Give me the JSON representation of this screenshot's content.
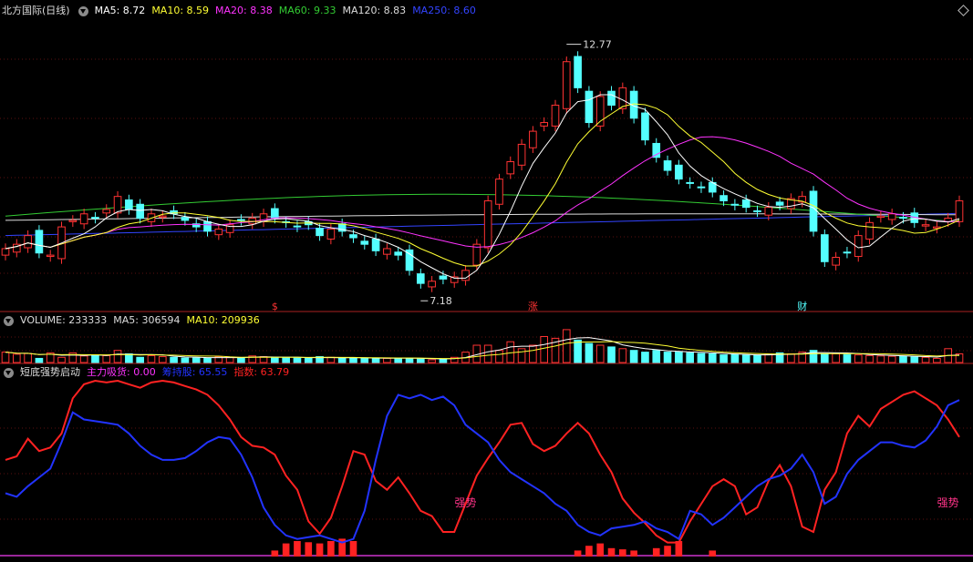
{
  "main": {
    "title": "北方国际(日线)",
    "ma": [
      {
        "label": "MA5: 8.72",
        "color": "#ffffff"
      },
      {
        "label": "MA10: 8.59",
        "color": "#ffff33"
      },
      {
        "label": "MA20: 8.38",
        "color": "#ff33ff"
      },
      {
        "label": "MA60: 9.33",
        "color": "#33cc33"
      },
      {
        "label": "MA120: 8.83",
        "color": "#dddddd"
      },
      {
        "label": "MA250: 8.60",
        "color": "#3344ff"
      }
    ],
    "high_label": "12.77",
    "low_label": "7.18",
    "markers": [
      {
        "label": "$",
        "x_index": 24
      },
      {
        "label": "涨",
        "x_index": 47
      },
      {
        "label": "财",
        "x_index": 71
      }
    ]
  },
  "volume": {
    "title": "VOLUME: 233333",
    "ma5": "MA5: 306594",
    "ma10": "MA10: 209936"
  },
  "indicator": {
    "title": "短底强势启动",
    "zlxh": "主力吸货: 0.00",
    "kpl": "筹持股: 65.55",
    "zs": "指数: 63.79",
    "labels": [
      {
        "text": "强势",
        "x_index": 41
      },
      {
        "text": "强势",
        "x_index": 84
      }
    ]
  },
  "colors": {
    "up": "#ff3333",
    "down": "#54ffff",
    "ind_red": "#ff2222",
    "ind_blue": "#2233ff",
    "purple": "#cc33cc"
  },
  "chart_data": [
    {
      "type": "candlestick",
      "name": "北方国际(日线)",
      "count": 86,
      "ylim": [
        6.8,
        13.4
      ],
      "close": [
        8.1,
        8.2,
        8.4,
        8.0,
        7.95,
        8.6,
        8.75,
        8.9,
        8.8,
        9.0,
        9.3,
        9.0,
        8.8,
        8.9,
        8.85,
        8.9,
        8.75,
        8.6,
        8.5,
        8.55,
        8.65,
        8.75,
        8.8,
        8.9,
        8.8,
        8.7,
        8.6,
        8.65,
        8.4,
        8.55,
        8.5,
        8.35,
        8.2,
        8.05,
        8.1,
        7.95,
        7.6,
        7.3,
        7.35,
        7.4,
        7.45,
        7.6,
        8.2,
        9.2,
        9.7,
        10.1,
        10.5,
        10.8,
        11.0,
        11.4,
        12.4,
        11.8,
        11.0,
        11.6,
        11.4,
        11.8,
        11.1,
        10.6,
        10.2,
        9.9,
        9.7,
        9.6,
        9.5,
        9.4,
        9.2,
        9.1,
        9.05,
        8.95,
        9.05,
        9.1,
        9.25,
        9.3,
        8.5,
        7.8,
        7.9,
        8.0,
        8.4,
        8.7,
        8.85,
        8.9,
        8.8,
        8.7,
        8.65,
        8.6,
        8.8,
        9.2
      ],
      "volume": [
        3.0,
        2.4,
        2.6,
        1.2,
        2.8,
        1.5,
        2.8,
        1.9,
        2.0,
        2.0,
        3.5,
        2.5,
        1.5,
        2.0,
        1.7,
        1.5,
        1.3,
        1.3,
        1.3,
        1.7,
        1.5,
        1.3,
        1.9,
        1.7,
        1.5,
        1.4,
        1.3,
        1.2,
        1.7,
        1.5,
        1.3,
        1.2,
        1.2,
        1.3,
        1.2,
        1.3,
        1.2,
        1.0,
        0.8,
        1.0,
        1.5,
        3.0,
        5.0,
        5.0,
        3.5,
        6.0,
        4.0,
        5.0,
        7.5,
        7.0,
        9.5,
        6.5,
        5.5,
        5.0,
        4.5,
        4.0,
        3.5,
        3.0,
        3.5,
        3.0,
        3.0,
        2.8,
        2.6,
        2.5,
        2.2,
        2.3,
        2.1,
        2.0,
        2.5,
        2.8,
        2.5,
        3.0,
        3.5,
        2.5,
        2.5,
        2.3,
        2.2,
        2.0,
        1.9,
        1.8,
        1.8,
        1.6,
        1.5,
        1.2,
        4.0,
        2.5
      ]
    },
    {
      "type": "line",
      "name": "短底强势启动",
      "ylim": [
        0,
        100
      ],
      "series": [
        {
          "name": "指数",
          "color": "#ff2222",
          "values": [
            55,
            57,
            67,
            60,
            62,
            70,
            90,
            98,
            100,
            99,
            100,
            98,
            96,
            99,
            100,
            99,
            97,
            95,
            92,
            86,
            78,
            68,
            63,
            62,
            58,
            46,
            38,
            20,
            13,
            22,
            40,
            60,
            58,
            43,
            38,
            45,
            36,
            26,
            23,
            14,
            14,
            30,
            46,
            56,
            65,
            75,
            76,
            64,
            60,
            63,
            70,
            76,
            70,
            58,
            48,
            33,
            25,
            19,
            12,
            8,
            8,
            20,
            30,
            40,
            44,
            40,
            24,
            28,
            43,
            52,
            40,
            17,
            14,
            38,
            48,
            70,
            80,
            74,
            84,
            88,
            92,
            94,
            90,
            86,
            78,
            68
          ]
        },
        {
          "name": "筹持股",
          "color": "#2233ff",
          "values": [
            36,
            34,
            40,
            45,
            50,
            65,
            82,
            78,
            77,
            76,
            75,
            70,
            63,
            58,
            55,
            55,
            56,
            60,
            65,
            68,
            67,
            58,
            45,
            28,
            18,
            12,
            10,
            11,
            12,
            10,
            8,
            10,
            26,
            55,
            80,
            92,
            90,
            92,
            89,
            91,
            86,
            75,
            70,
            65,
            55,
            48,
            44,
            40,
            36,
            30,
            26,
            18,
            14,
            12,
            16,
            17,
            18,
            20,
            16,
            14,
            10,
            26,
            24,
            18,
            22,
            28,
            34,
            40,
            44,
            46,
            50,
            58,
            48,
            30,
            34,
            47,
            55,
            60,
            65,
            65,
            63,
            62,
            66,
            74,
            86,
            89
          ]
        }
      ]
    }
  ]
}
